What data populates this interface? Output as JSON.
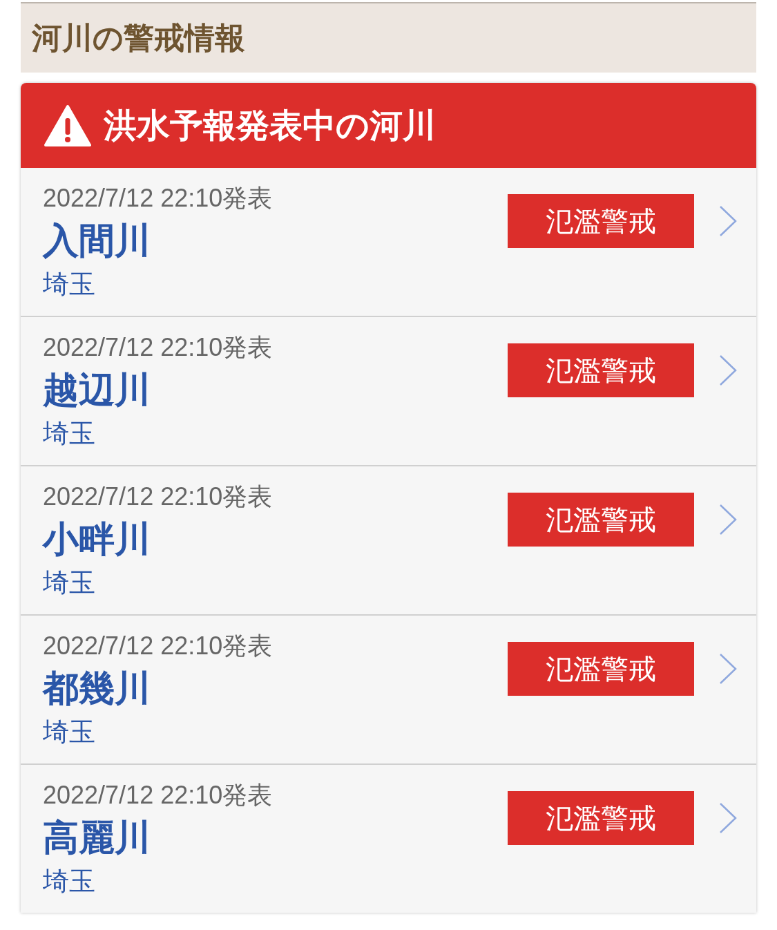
{
  "section": {
    "title": "河川の警戒情報"
  },
  "alert": {
    "title": "洪水予報発表中の河川"
  },
  "rivers": [
    {
      "issued": "2022/7/12 22:10発表",
      "name": "入間川",
      "prefecture": "埼玉",
      "level_label": "氾濫警戒"
    },
    {
      "issued": "2022/7/12 22:10発表",
      "name": "越辺川",
      "prefecture": "埼玉",
      "level_label": "氾濫警戒"
    },
    {
      "issued": "2022/7/12 22:10発表",
      "name": "小畔川",
      "prefecture": "埼玉",
      "level_label": "氾濫警戒"
    },
    {
      "issued": "2022/7/12 22:10発表",
      "name": "都幾川",
      "prefecture": "埼玉",
      "level_label": "氾濫警戒"
    },
    {
      "issued": "2022/7/12 22:10発表",
      "name": "高麗川",
      "prefecture": "埼玉",
      "level_label": "氾濫警戒"
    }
  ]
}
